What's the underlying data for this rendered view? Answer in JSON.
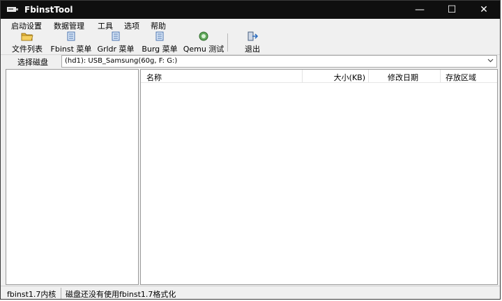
{
  "window": {
    "title": "FbinstTool",
    "minimize": "—",
    "maximize": "☐",
    "close": "✕"
  },
  "menu": [
    "启动设置",
    "数据管理",
    "工具",
    "选项",
    "帮助"
  ],
  "toolbar": {
    "file_list": "文件列表",
    "fbinst_menu": "Fbinst 菜单",
    "grldr_menu": "Grldr 菜单",
    "burg_menu": "Burg 菜单",
    "qemu_test": "Qemu 测试",
    "exit": "退出"
  },
  "disk": {
    "label": "选择磁盘",
    "selected": "(hd1): USB_Samsung(60g, F: G:)"
  },
  "file_table": {
    "columns": [
      "名称",
      "大小(KB)",
      "修改日期",
      "存放区域"
    ],
    "rows": []
  },
  "status": {
    "version": "fbinst1.7内核",
    "message": "磁盘还没有使用fbinst1.7格式化"
  },
  "colors": {
    "titlebar": "#0f0f0f",
    "background": "#f0f0f0",
    "pane": "#ffffff"
  }
}
